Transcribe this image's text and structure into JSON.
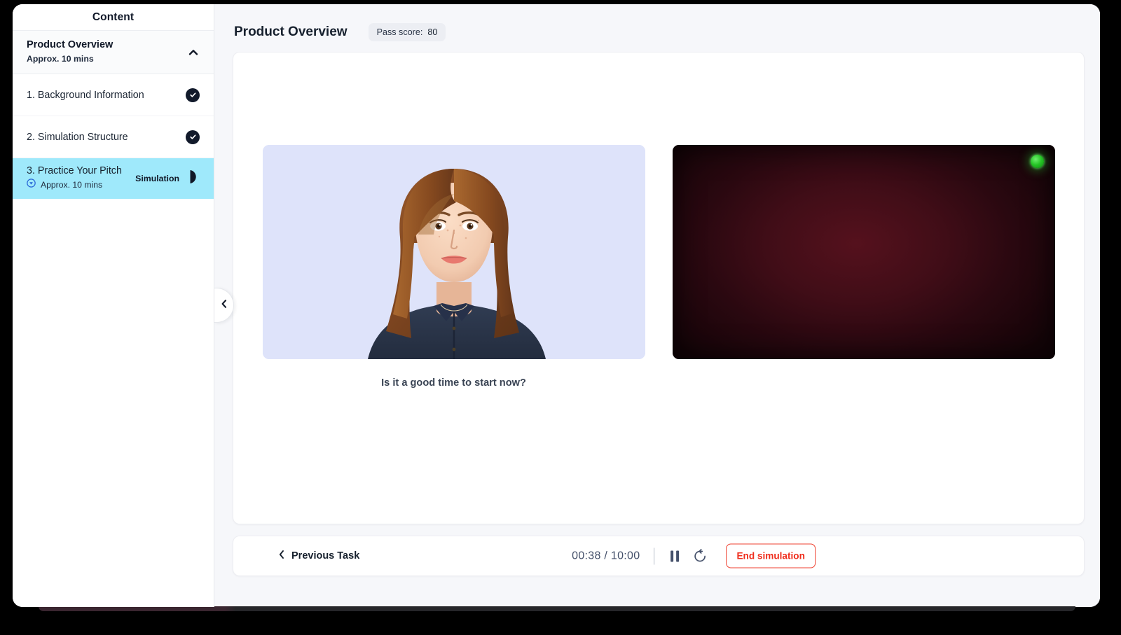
{
  "sidebar": {
    "title": "Content",
    "section": {
      "title": "Product Overview",
      "duration": "Approx. 10 mins",
      "collapse_icon": "chevron-up-icon"
    },
    "lessons": [
      {
        "label": "1. Background Information",
        "status_icon": "check-circle-icon",
        "completed": true
      },
      {
        "label": "2. Simulation Structure",
        "status_icon": "check-circle-icon",
        "completed": true
      },
      {
        "label": "3. Practice Your Pitch",
        "duration": "Approx. 10 mins",
        "badge": "Simulation",
        "type_icon": "simulation-circle-icon",
        "play_icon": "half-circle-play-icon",
        "active": true
      }
    ],
    "collapse_handle_icon": "chevron-left-icon"
  },
  "header": {
    "title": "Product Overview",
    "pass_score_label": "Pass score:",
    "pass_score_value": "80"
  },
  "stage": {
    "avatar": {
      "name": "ai-avatar-video",
      "background_color": "#dee3fa",
      "caption": "Is it a good time to start now?"
    },
    "webcam": {
      "name": "user-webcam-feed",
      "background_color": "#400d17",
      "recording_indicator_color": "#25c425"
    }
  },
  "controls": {
    "previous_task_label": "Previous Task",
    "previous_icon": "chevron-left-icon",
    "timer": "00:38 / 10:00",
    "pause_icon": "pause-icon",
    "restart_icon": "restart-icon",
    "end_label": "End simulation",
    "end_color": "#ef2d1c"
  }
}
